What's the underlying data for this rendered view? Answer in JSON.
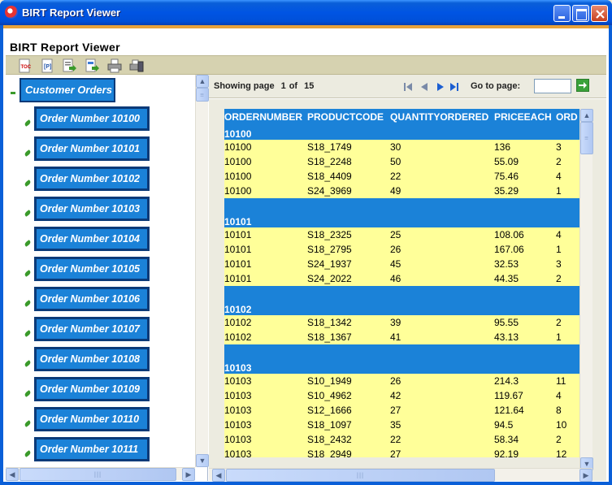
{
  "window": {
    "title": "BIRT Report Viewer"
  },
  "app": {
    "title": "BIRT Report Viewer"
  },
  "toolbar": {
    "icons": [
      "toc-icon",
      "parameters-icon",
      "export-data-icon",
      "export-report-icon",
      "print-icon",
      "print-server-icon"
    ]
  },
  "tree": {
    "root_label": "Customer Orders",
    "items": [
      "Order Number 10100",
      "Order Number 10101",
      "Order Number 10102",
      "Order Number 10103",
      "Order Number 10104",
      "Order Number 10105",
      "Order Number 10106",
      "Order Number 10107",
      "Order Number 10108",
      "Order Number 10109",
      "Order Number 10110",
      "Order Number 10111"
    ]
  },
  "navigation": {
    "showing_label": "Showing page",
    "current_page": "1",
    "of_label": "of",
    "total_pages": "15",
    "goto_label": "Go to page:",
    "goto_value": ""
  },
  "report": {
    "columns": [
      "ORDERNUMBER",
      "PRODUCTCODE",
      "QUANTITYORDERED",
      "PRICEEACH",
      "ORD"
    ],
    "groups": [
      {
        "order": "10100",
        "rows": [
          [
            "10100",
            "S18_1749",
            "30",
            "136",
            "3"
          ],
          [
            "10100",
            "S18_2248",
            "50",
            "55.09",
            "2"
          ],
          [
            "10100",
            "S18_4409",
            "22",
            "75.46",
            "4"
          ],
          [
            "10100",
            "S24_3969",
            "49",
            "35.29",
            "1"
          ]
        ]
      },
      {
        "order": "10101",
        "rows": [
          [
            "10101",
            "S18_2325",
            "25",
            "108.06",
            "4"
          ],
          [
            "10101",
            "S18_2795",
            "26",
            "167.06",
            "1"
          ],
          [
            "10101",
            "S24_1937",
            "45",
            "32.53",
            "3"
          ],
          [
            "10101",
            "S24_2022",
            "46",
            "44.35",
            "2"
          ]
        ]
      },
      {
        "order": "10102",
        "rows": [
          [
            "10102",
            "S18_1342",
            "39",
            "95.55",
            "2"
          ],
          [
            "10102",
            "S18_1367",
            "41",
            "43.13",
            "1"
          ]
        ]
      },
      {
        "order": "10103",
        "rows": [
          [
            "10103",
            "S10_1949",
            "26",
            "214.3",
            "11"
          ],
          [
            "10103",
            "S10_4962",
            "42",
            "119.67",
            "4"
          ],
          [
            "10103",
            "S12_1666",
            "27",
            "121.64",
            "8"
          ],
          [
            "10103",
            "S18_1097",
            "35",
            "94.5",
            "10"
          ],
          [
            "10103",
            "S18_2432",
            "22",
            "58.34",
            "2"
          ],
          [
            "10103",
            "S18_2949",
            "27",
            "92.19",
            "12"
          ]
        ]
      }
    ]
  },
  "colors": {
    "title_bar": "#0054e3",
    "accent_orange": "#e8a23a",
    "toolbar_bg": "#d6d2b0",
    "group_blue": "#1b82d8",
    "row_yellow": "#ffff99",
    "node_border": "#0b3a78"
  }
}
